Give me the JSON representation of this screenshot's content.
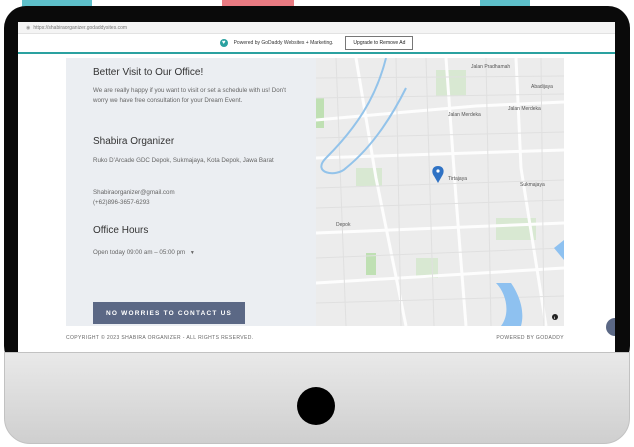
{
  "browser": {
    "url": "https://shabiraorganizer.godaddysites.com"
  },
  "banner": {
    "text": "Powered by GoDaddy Websites + Marketing.",
    "upgrade_label": "Upgrade to Remove Ad"
  },
  "visit": {
    "heading": "Better Visit to Our Office!",
    "body": "We are really happy if you want to visit or set a schedule with us! Don't worry we have free consultation for your Dream Event."
  },
  "org": {
    "name": "Shabira Organizer",
    "address": "Ruko D'Arcade GDC Depok, Sukmajaya, Kota Depok, Jawa Barat",
    "email": "Shabiraorganizer@gmail.com",
    "phone": "(+62)896-3657-6293"
  },
  "hours": {
    "heading": "Office Hours",
    "today": "Open today 09:00 am – 05:00 pm"
  },
  "cta_label": "NO WORRIES TO CONTACT US",
  "map": {
    "labels": [
      "Jalan Pradhamah",
      "Abadijaya",
      "Jalan Merdeka",
      "Jalan Merdeka",
      "Tirtajaya",
      "Sukmajaya",
      "Depok"
    ],
    "pin_color": "#2f72c4"
  },
  "footer": {
    "copyright": "COPYRIGHT © 2023 SHABIRA ORGANIZER - ALL RIGHTS RESERVED.",
    "powered": "POWERED BY GODADDY"
  }
}
